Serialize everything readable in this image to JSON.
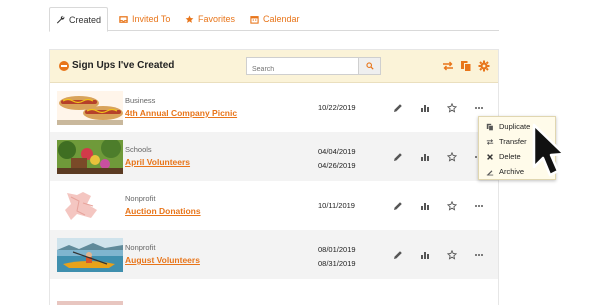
{
  "tabs": [
    {
      "label": "Created",
      "icon": "wrench-icon",
      "active": true
    },
    {
      "label": "Invited To",
      "icon": "inbox-icon",
      "active": false
    },
    {
      "label": "Favorites",
      "icon": "star-icon",
      "active": false
    },
    {
      "label": "Calendar",
      "icon": "calendar-icon",
      "active": false
    }
  ],
  "panel": {
    "title": "Sign Ups I've Created",
    "search_placeholder": "Search",
    "header_icons": [
      "transfer-icon",
      "copy-icon",
      "gear-icon"
    ]
  },
  "rows": [
    {
      "category": "Business",
      "name": "4th Annual Company Picnic",
      "dates": [
        "10/22/2019"
      ],
      "thumb": "hotdogs"
    },
    {
      "category": "Schools",
      "name": "April Volunteers",
      "dates": [
        "04/04/2019",
        "04/26/2019"
      ],
      "thumb": "garden"
    },
    {
      "category": "Nonprofit",
      "name": "Auction Donations",
      "dates": [
        "10/11/2019"
      ],
      "thumb": "clothing"
    },
    {
      "category": "Nonprofit",
      "name": "August Volunteers",
      "dates": [
        "08/01/2019",
        "08/31/2019"
      ],
      "thumb": "kayak"
    }
  ],
  "menu": {
    "items": [
      {
        "label": "Duplicate",
        "icon": "duplicate-icon"
      },
      {
        "label": "Transfer",
        "icon": "transfer-icon"
      },
      {
        "label": "Delete",
        "icon": "delete-x-icon"
      },
      {
        "label": "Archive",
        "icon": "archive-icon"
      }
    ]
  },
  "colors": {
    "accent": "#e8751a",
    "header_bg": "#fbf3d8",
    "row_alt": "#f3f3f3"
  }
}
